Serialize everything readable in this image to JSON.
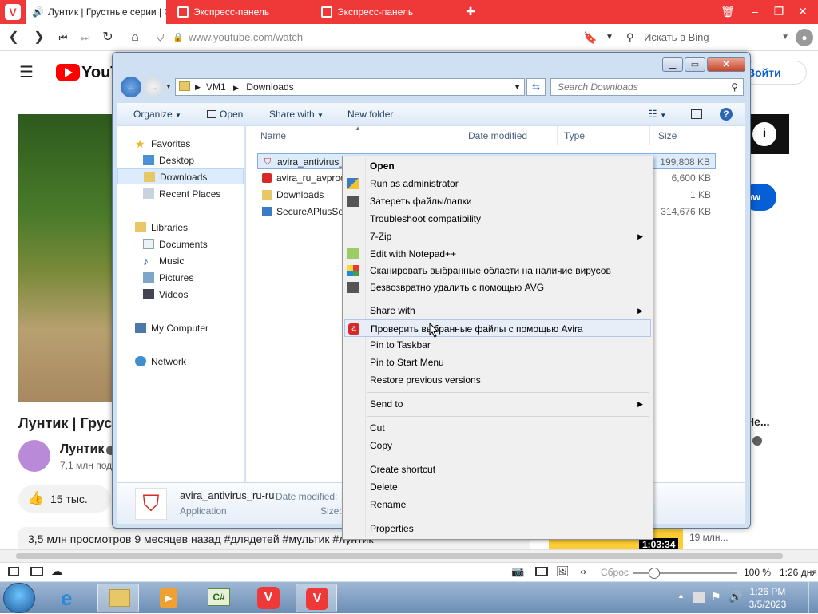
{
  "browser": {
    "tabs": [
      {
        "label": "Лунтик | Грустные серии | Сб"
      },
      {
        "label": "Экспресс-панель"
      },
      {
        "label": "Экспресс-панель"
      }
    ],
    "url": "www.youtube.com/watch",
    "search_placeholder": "Искать в Bing",
    "status": {
      "reset_label": "Сброс",
      "zoom": "100 %",
      "time": "1:26 дня"
    }
  },
  "youtube": {
    "logo_text": "YouTu",
    "signin_label": "Войти",
    "subscribe_label": "ow",
    "video_title": "Лунтик | Груст",
    "channel": "Лунтик",
    "subscribers": "7,1 млн под",
    "likes": "15 тыс.",
    "description": "3,5 млн просмотров  9 месяцев назад  #длядетей #мультик #лунтик",
    "side_title": "Не...",
    "side_duration": "1:03:34",
    "side_views": "19 млн..."
  },
  "explorer": {
    "breadcrumb": [
      "VM1",
      "Downloads"
    ],
    "search_placeholder": "Search Downloads",
    "toolbar": {
      "organize": "Organize",
      "open": "Open",
      "share": "Share with",
      "new_folder": "New folder"
    },
    "nav": {
      "favorites": "Favorites",
      "desktop": "Desktop",
      "downloads": "Downloads",
      "recent": "Recent Places",
      "libraries": "Libraries",
      "documents": "Documents",
      "music": "Music",
      "pictures": "Pictures",
      "videos": "Videos",
      "computer": "My Computer",
      "network": "Network"
    },
    "columns": {
      "name": "Name",
      "date": "Date modified",
      "type": "Type",
      "size": "Size"
    },
    "files": [
      {
        "name": "avira_antivirus_",
        "size": "199,808 KB"
      },
      {
        "name": "avira_ru_avproc",
        "size": "6,600 KB"
      },
      {
        "name": "Downloads",
        "size": "1 KB"
      },
      {
        "name": "SecureAPlusSet",
        "size": "314,676 KB"
      }
    ],
    "details": {
      "name": "avira_antivirus_ru-ru",
      "type": "Application",
      "date_label": "Date modified:",
      "size_label": "Size:"
    }
  },
  "context_menu": {
    "open": "Open",
    "run_admin": "Run as administrator",
    "shred": "Затереть файлы/папки",
    "troubleshoot": "Troubleshoot compatibility",
    "sevenzip": "7-Zip",
    "notepad": "Edit with Notepad++",
    "scan_areas": "Сканировать выбранные области на наличие вирусов",
    "avg_delete": "Безвозвратно удалить с помощью AVG",
    "share_with": "Share with",
    "avira_scan": "Проверить выбранные файлы с помощью Avira",
    "pin_taskbar": "Pin to Taskbar",
    "pin_start": "Pin to Start Menu",
    "restore": "Restore previous versions",
    "send_to": "Send to",
    "cut": "Cut",
    "copy": "Copy",
    "create_shortcut": "Create shortcut",
    "delete": "Delete",
    "rename": "Rename",
    "properties": "Properties"
  },
  "taskbar": {
    "time": "1:26 PM",
    "date": "3/5/2023"
  }
}
